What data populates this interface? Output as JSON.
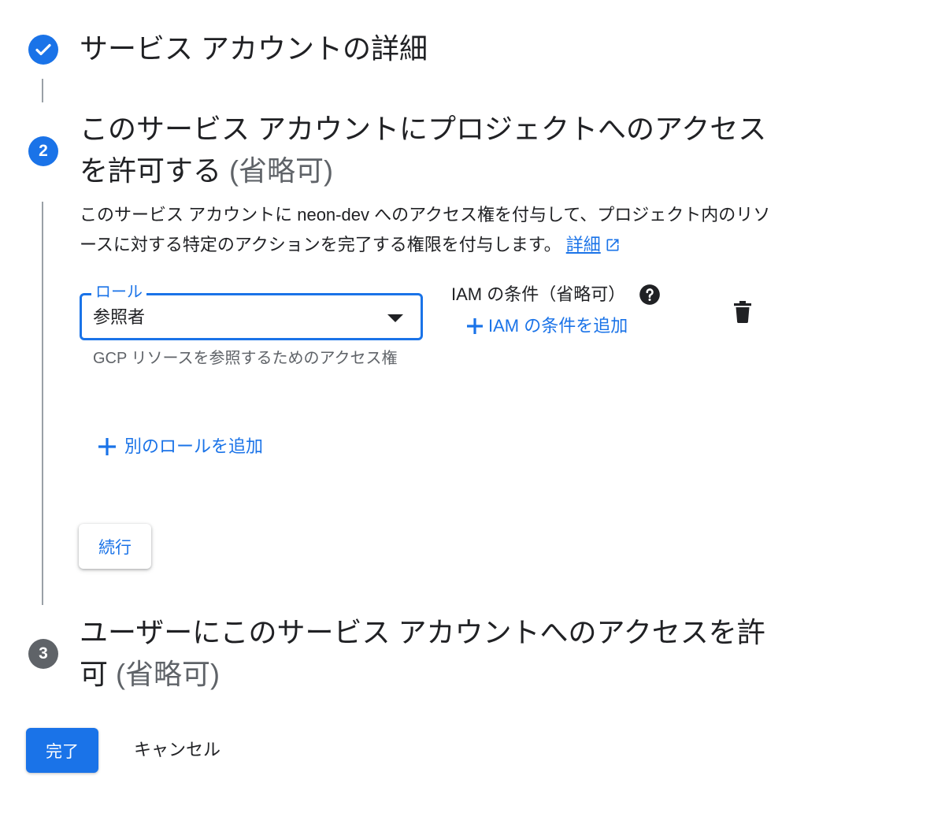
{
  "steps": [
    {
      "number": "",
      "icon": "check-icon",
      "title": "サービス アカウントの詳細"
    },
    {
      "number": "2",
      "title": "このサービス アカウントにプロジェクトへのアクセスを許可する",
      "optional": "(省略可)"
    },
    {
      "number": "3",
      "title": "ユーザーにこのサービス アカウントへのアクセスを許可",
      "optional": "(省略可)"
    }
  ],
  "description": {
    "text": "このサービス アカウントに neon-dev へのアクセス権を付与して、プロジェクト内のリソースに対する特定のアクションを完了する権限を付与します。",
    "link": "詳細"
  },
  "role": {
    "label": "ロール",
    "value": "参照者",
    "helper": "GCP リソースを参照するためのアクセス権"
  },
  "iam": {
    "label": "IAM の条件（省略可）",
    "add_label": "IAM の条件を追加"
  },
  "add_role_label": "別のロールを追加",
  "continue_label": "続行",
  "done_label": "完了",
  "cancel_label": "キャンセル",
  "colors": {
    "accent": "#1a73e8",
    "inactive_step": "#5f6368"
  }
}
